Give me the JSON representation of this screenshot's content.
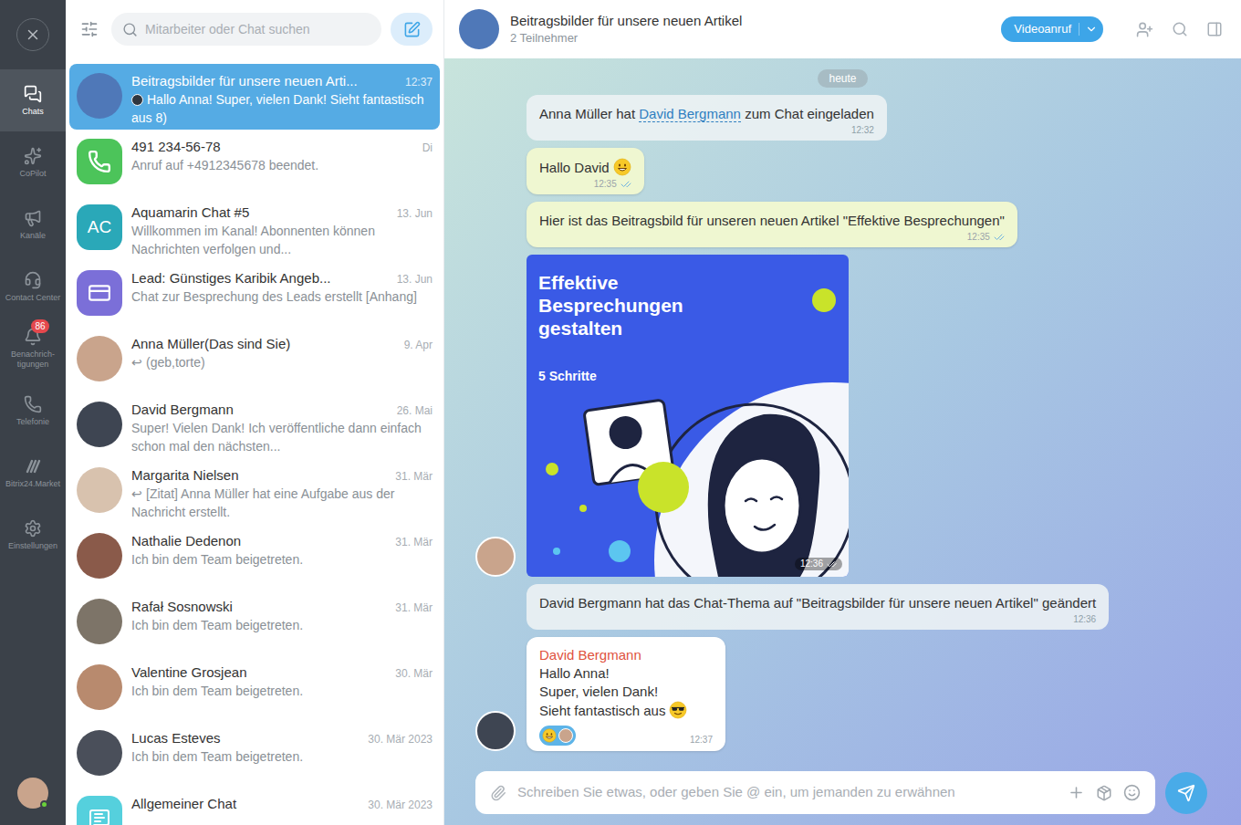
{
  "nav": {
    "items": [
      {
        "label": "Chats",
        "selected": true
      },
      {
        "label": "CoPilot",
        "selected": false
      },
      {
        "label": "Kanäle",
        "selected": false
      },
      {
        "label": "Contact Center",
        "selected": false
      },
      {
        "label": "Benachrich-tigungen",
        "selected": false,
        "badge": "86"
      },
      {
        "label": "Telefonie",
        "selected": false
      },
      {
        "label": "Bitrix24.Market",
        "selected": false
      },
      {
        "label": "Einstellungen",
        "selected": false
      }
    ],
    "user": {
      "online": true,
      "color": "#c9a48c"
    }
  },
  "search": {
    "placeholder": "Mitarbeiter oder Chat suchen"
  },
  "chats": [
    {
      "title": "Beitragsbilder für unsere neuen Arti...",
      "preview": "Hallo Anna! Super, vielen Dank! Sieht fantastisch aus 8)",
      "author_avatar": true,
      "time": "12:37",
      "selected": true,
      "avatar": {
        "kind": "photo",
        "color": "#4f78b8"
      }
    },
    {
      "title": "491 234-56-78",
      "preview": "Anruf auf +4912345678 beendet.",
      "time": "Di",
      "selected": false,
      "avatar": {
        "kind": "phone",
        "color": "#4cc45a"
      }
    },
    {
      "title": "Aquamarin Chat #5",
      "preview": "Willkommen im Kanal! Abonnenten können Nachrichten verfolgen und...",
      "time": "13. Jun",
      "selected": false,
      "avatar": {
        "kind": "initials",
        "initials": "AC",
        "color": "#2aa8b8"
      }
    },
    {
      "title": "Lead: Günstiges Karibik Angeb...",
      "preview": "Chat zur Besprechung des Leads erstellt [Anhang]",
      "time": "13. Jun",
      "selected": false,
      "avatar": {
        "kind": "lead",
        "color": "#7b6fd8"
      }
    },
    {
      "title": "Anna Müller",
      "title_note": "(Das sind Sie)",
      "prefix": "↩",
      "preview": "(geb,torte)",
      "time": "9. Apr",
      "selected": false,
      "avatar": {
        "kind": "photo",
        "color": "#c9a48c"
      }
    },
    {
      "title": "David Bergmann",
      "preview": "Super! Vielen Dank! Ich veröffentliche dann einfach schon mal den nächsten...",
      "time": "26. Mai",
      "selected": false,
      "avatar": {
        "kind": "photo",
        "color": "#3e4552"
      }
    },
    {
      "title": "Margarita Nielsen",
      "prefix": "↩",
      "preview": "[Zitat] Anna Müller hat eine Aufgabe aus der Nachricht erstellt.",
      "time": "31. Mär",
      "selected": false,
      "avatar": {
        "kind": "photo",
        "color": "#d8c2ae"
      }
    },
    {
      "title": "Nathalie Dedenon",
      "preview": "Ich bin dem Team beigetreten.",
      "time": "31. Mär",
      "selected": false,
      "avatar": {
        "kind": "photo",
        "color": "#8a5a4a"
      }
    },
    {
      "title": "Rafał Sosnowski",
      "preview": "Ich bin dem Team beigetreten.",
      "time": "31. Mär",
      "selected": false,
      "avatar": {
        "kind": "photo",
        "color": "#7d7468"
      }
    },
    {
      "title": "Valentine Grosjean",
      "preview": "Ich bin dem Team beigetreten.",
      "time": "30. Mär",
      "selected": false,
      "avatar": {
        "kind": "photo",
        "color": "#b88a6e"
      }
    },
    {
      "title": "Lucas Esteves",
      "preview": "Ich bin dem Team beigetreten.",
      "time": "30. Mär 2023",
      "selected": false,
      "avatar": {
        "kind": "photo",
        "color": "#4a4f5a"
      }
    },
    {
      "title": "Allgemeiner Chat",
      "time": "30. Mär 2023",
      "selected": false,
      "avatar": {
        "kind": "group",
        "color": "#55d0dd"
      }
    }
  ],
  "chat": {
    "title": "Beitragsbilder für unsere neuen Artikel",
    "subtitle": "2 Teilnehmer",
    "avatar_color": "#4f78b8",
    "call_button": "Videoanruf",
    "date_badge": "heute",
    "messages": [
      {
        "kind": "system",
        "before": "Anna Müller hat ",
        "link": "David Bergmann",
        "after": " zum Chat eingeladen",
        "time": "12:32"
      },
      {
        "kind": "own-text",
        "text": "Hallo David",
        "emoji": "grinning",
        "time": "12:35",
        "read": true
      },
      {
        "kind": "own-text",
        "text": "Hier ist das Beitragsbild für unseren neuen Artikel \"Effektive Besprechungen\"",
        "time": "12:35",
        "read": true
      },
      {
        "kind": "own-image",
        "image_title": "Effektive Besprechungen gestalten",
        "image_subtitle": "5 Schritte",
        "time": "12:36",
        "read": true,
        "avatar_color": "#c9a48c"
      },
      {
        "kind": "system",
        "before": "David Bergmann hat das Chat-Thema auf \"Beitragsbilder für unsere neuen Artikel\" geändert",
        "time": "12:36"
      },
      {
        "kind": "incoming",
        "author": "David Bergmann",
        "lines": [
          "Hallo Anna!",
          "Super, vielen Dank!",
          "Sieht fantastisch aus"
        ],
        "emoji": "sunglasses",
        "reactions": [
          {
            "kind": "emoji"
          },
          {
            "kind": "avatar",
            "color": "#c9a48c"
          }
        ],
        "time": "12:37",
        "avatar_color": "#3e4552"
      }
    ]
  },
  "composer": {
    "placeholder": "Schreiben Sie etwas, oder geben Sie @ ein, um jemanden zu erwähnen"
  }
}
